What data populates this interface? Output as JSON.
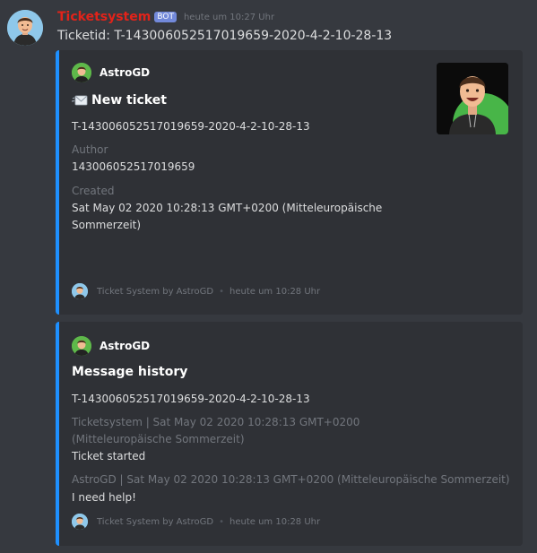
{
  "message": {
    "username": "Ticketsystem",
    "bot_tag": "BOT",
    "timestamp": "heute um 10:27 Uhr",
    "content": "Ticketid: T-143006052517019659-2020-4-2-10-28-13",
    "colors": {
      "username": "#e2231a",
      "embed_accent": "#1e90ff",
      "bot_tag": "#7289da"
    }
  },
  "embeds": [
    {
      "author": "AstroGD",
      "title": "New ticket",
      "title_icon": "envelope-icon",
      "description": "T-143006052517019659-2020-4-2-10-28-13",
      "fields": [
        {
          "name": "Author",
          "value": "143006052517019659"
        },
        {
          "name": "Created",
          "value": "Sat May 02 2020 10:28:13 GMT+0200 (Mitteleuropäische Sommerzeit)"
        }
      ],
      "footer": "Ticket System by AstroGD",
      "footer_time": "heute um 10:28 Uhr"
    },
    {
      "author": "AstroGD",
      "title": "Message history",
      "description": "T-143006052517019659-2020-4-2-10-28-13",
      "fields": [
        {
          "name": "Ticketsystem | Sat May 02 2020 10:28:13 GMT+0200 (Mitteleuropäische Sommerzeit)",
          "value": "Ticket started"
        },
        {
          "name": "AstroGD | Sat May 02 2020 10:28:13 GMT+0200 (Mitteleuropäische Sommerzeit)",
          "value": "I need help!"
        }
      ],
      "footer": "Ticket System by AstroGD",
      "footer_time": "heute um 10:28 Uhr"
    }
  ],
  "footer_separator": "•"
}
